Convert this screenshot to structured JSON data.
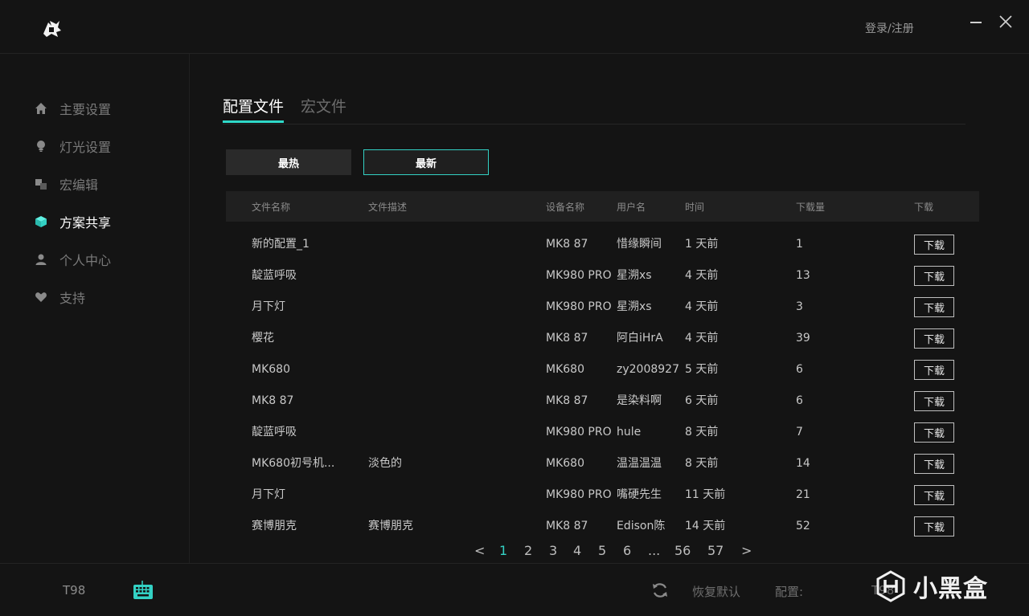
{
  "header": {
    "login_label": "登录/注册",
    "minimize_icon": "minimize-icon",
    "close_icon": "close-icon"
  },
  "sidebar": {
    "items": [
      {
        "label": "主要设置",
        "icon": "home-icon",
        "active": false
      },
      {
        "label": "灯光设置",
        "icon": "bulb-icon",
        "active": false
      },
      {
        "label": "宏编辑",
        "icon": "macro-icon",
        "active": false
      },
      {
        "label": "方案共享",
        "icon": "cube-icon",
        "active": true
      },
      {
        "label": "个人中心",
        "icon": "user-icon",
        "active": false
      },
      {
        "label": "支持",
        "icon": "heart-icon",
        "active": false
      }
    ]
  },
  "tabs": [
    {
      "label": "配置文件",
      "active": true
    },
    {
      "label": "宏文件",
      "active": false
    }
  ],
  "filters": [
    {
      "label": "最热",
      "selected": false
    },
    {
      "label": "最新",
      "selected": true
    }
  ],
  "table": {
    "headers": [
      "文件名称",
      "文件描述",
      "设备名称",
      "用户名",
      "时间",
      "下载量",
      "下载"
    ],
    "download_label": "下载",
    "rows": [
      {
        "name": "新的配置_1",
        "desc": "",
        "device": "MK8 87",
        "user": "惜缘瞬间",
        "time": "1 天前",
        "downloads": "1"
      },
      {
        "name": "靛蓝呼吸",
        "desc": "",
        "device": "MK980 PRO",
        "user": "星溯xs",
        "time": "4 天前",
        "downloads": "13"
      },
      {
        "name": "月下灯",
        "desc": "",
        "device": "MK980 PRO",
        "user": "星溯xs",
        "time": "4 天前",
        "downloads": "3"
      },
      {
        "name": "樱花",
        "desc": "",
        "device": "MK8 87",
        "user": "阿白iHrA",
        "time": "4 天前",
        "downloads": "39"
      },
      {
        "name": "MK680",
        "desc": "",
        "device": "MK680",
        "user": "zy2008927",
        "time": "5 天前",
        "downloads": "6"
      },
      {
        "name": "MK8 87",
        "desc": "",
        "device": "MK8 87",
        "user": "是染料啊",
        "time": "6 天前",
        "downloads": "6"
      },
      {
        "name": "靛蓝呼吸",
        "desc": "",
        "device": "MK980 PRO",
        "user": "hule",
        "time": "8 天前",
        "downloads": "7"
      },
      {
        "name": "MK680初号机...",
        "desc": "淡色的",
        "device": "MK680",
        "user": "温温温温",
        "time": "8 天前",
        "downloads": "14"
      },
      {
        "name": "月下灯",
        "desc": "",
        "device": "MK980 PRO",
        "user": "嘴硬先生",
        "time": "11 天前",
        "downloads": "21"
      },
      {
        "name": "赛博朋克",
        "desc": "赛博朋克",
        "device": "MK8 87",
        "user": "Edison陈",
        "time": "14 天前",
        "downloads": "52"
      }
    ]
  },
  "pagination": {
    "prev": "<",
    "next": ">",
    "pages": [
      "1",
      "2",
      "3",
      "4",
      "5",
      "6",
      "...",
      "56",
      "57"
    ],
    "current": "1"
  },
  "footer": {
    "device_name": "T98",
    "restore_label": "恢复默认",
    "config_label": "配置:",
    "config_value": "T98",
    "watermark_text": "小黑盒"
  },
  "colors": {
    "accent": "#33d1c4",
    "background": "#141414"
  }
}
